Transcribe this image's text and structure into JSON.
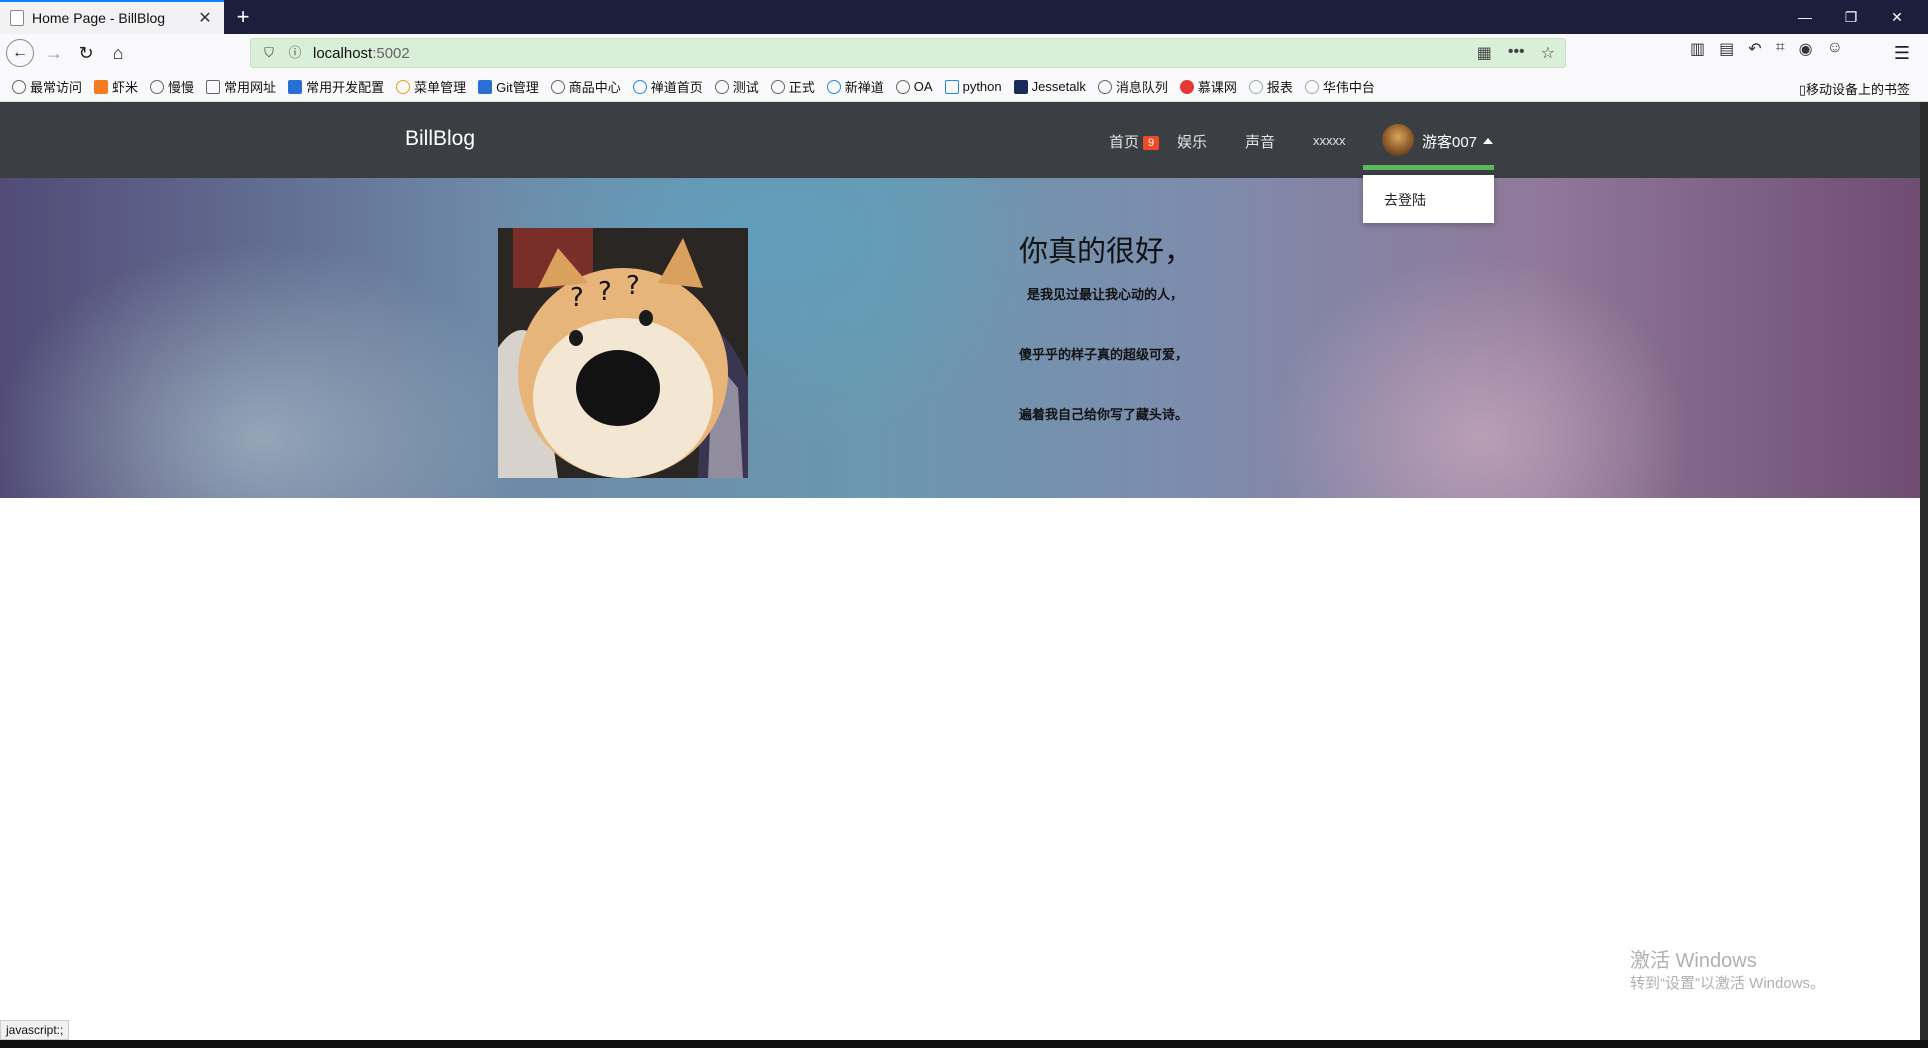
{
  "browser": {
    "tab_title": "Home Page - BillBlog",
    "tab_close": "✕",
    "new_tab": "+",
    "url_host": "localhost",
    "url_port": ":5002",
    "window": {
      "minimize": "—",
      "restore": "❐",
      "close": "✕"
    }
  },
  "bookmarks": {
    "items": [
      {
        "label": "最常访问",
        "icon": "gear-icon"
      },
      {
        "label": "虾米",
        "icon": "xiami-icon"
      },
      {
        "label": "慢慢",
        "icon": "leaf-icon"
      },
      {
        "label": "常用网址",
        "icon": "folder-icon"
      },
      {
        "label": "常用开发配置",
        "icon": "flag-icon"
      },
      {
        "label": "菜单管理",
        "icon": "circle-icon"
      },
      {
        "label": "Git管理",
        "icon": "flag-icon"
      },
      {
        "label": "商品中心",
        "icon": "globe-icon"
      },
      {
        "label": "禅道首页",
        "icon": "zentao-icon"
      },
      {
        "label": "测试",
        "icon": "globe-icon"
      },
      {
        "label": "正式",
        "icon": "globe-icon"
      },
      {
        "label": "新禅道",
        "icon": "zentao-icon"
      },
      {
        "label": "OA",
        "icon": "globe-icon"
      },
      {
        "label": "python",
        "icon": "rocket-icon"
      },
      {
        "label": "Jessetalk",
        "icon": "j-icon"
      },
      {
        "label": "消息队列",
        "icon": "globe-icon"
      },
      {
        "label": "慕课网",
        "icon": "fire-icon"
      },
      {
        "label": "报表",
        "icon": "star-icon"
      },
      {
        "label": "华伟中台",
        "icon": "star-icon"
      }
    ],
    "mobile": "移动设备上的书签"
  },
  "site": {
    "brand": "BillBlog",
    "nav": {
      "home": "首页",
      "home_badge": "9",
      "entertainment": "娱乐",
      "sound": "声音",
      "xxxxx": "xxxxx"
    },
    "user": {
      "name": "游客007"
    },
    "dropdown": {
      "login": "去登陆"
    },
    "hero": {
      "title": "你真的很好，",
      "lines": [
        "是我见过最让我心动的人，",
        "傻乎乎的样子真的超级可爱，",
        "遍着我自己给你写了藏头诗。"
      ]
    }
  },
  "os": {
    "watermark_title": "激活 Windows",
    "watermark_sub": "转到“设置”以激活 Windows。",
    "status_text": "javascript:;"
  },
  "colors": {
    "navbar": "#3b3e42",
    "badge": "#f04a24",
    "active_underline": "#5cb85c",
    "urlbar": "#d9efd8"
  }
}
